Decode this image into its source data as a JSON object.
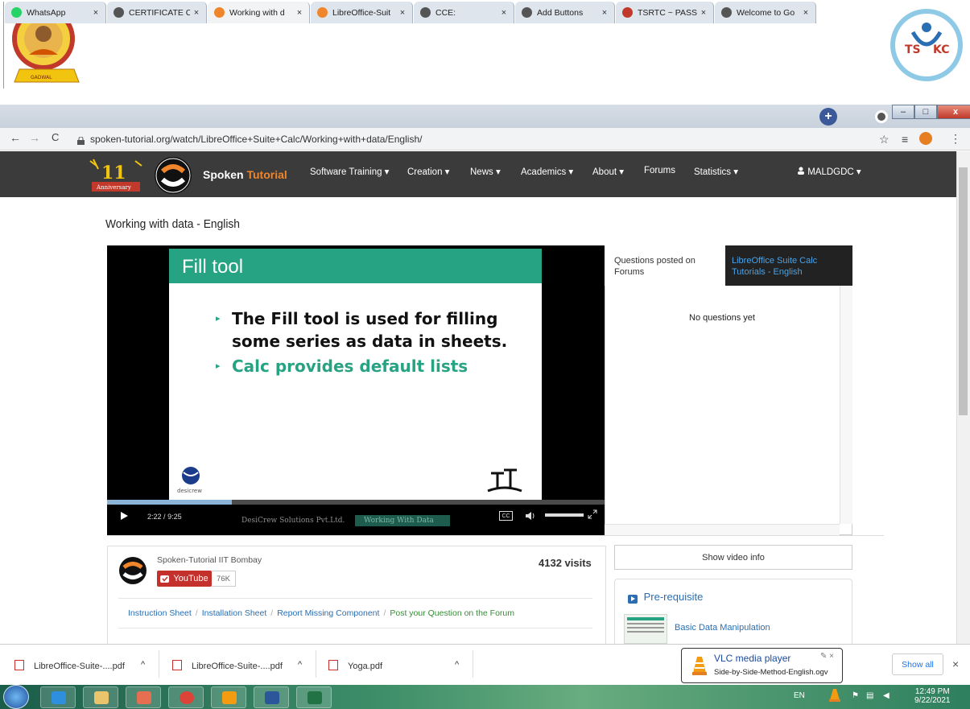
{
  "tabs": [
    {
      "label": "WhatsApp",
      "close": "×",
      "color": "#25d366"
    },
    {
      "label": "CERTIFICATE CO",
      "close": "×",
      "color": "#555555"
    },
    {
      "label": "Working with d",
      "close": "×",
      "color": "#f0862b"
    },
    {
      "label": "LibreOffice-Suit",
      "close": "×",
      "color": "#f0862b"
    },
    {
      "label": "CCE:",
      "close": "×",
      "color": "#555555"
    },
    {
      "label": "Add Buttons",
      "close": "×",
      "color": "#555555"
    },
    {
      "label": "TSRTC ~ PASS",
      "close": "×",
      "color": "#c0392b"
    },
    {
      "label": "Welcome to Go",
      "close": "×",
      "color": "#555555"
    }
  ],
  "browser": {
    "new_tab": "+",
    "url": "spoken-tutorial.org/watch/LibreOffice+Suite+Calc/Working+with+data/English/",
    "back": "←",
    "forward": "→",
    "reload": "C",
    "star": "☆",
    "reading_list": "≡",
    "menu": "⋮"
  },
  "window": {
    "minimize": "–",
    "maximize": "□",
    "close": "x"
  },
  "site": {
    "anniversary": "11",
    "anniversary_label": "Anniversary",
    "brand_a": "Spoken",
    "brand_b": "Tutorial",
    "nav": [
      "Software Training ▾",
      "Creation ▾",
      "News ▾",
      "Academics ▾",
      "About ▾",
      "Forums",
      "Statistics ▾"
    ],
    "user": "MALDGDC ▾"
  },
  "page": {
    "title": "Working with data - English"
  },
  "video": {
    "slide_title": "Fill tool",
    "bullets": [
      {
        "line1": "The Fill tool is used for filling",
        "line2": "some series as data in sheets.",
        "color": "#111111"
      },
      {
        "line1": "Calc provides default lists",
        "line2": "",
        "color": "#26a383"
      }
    ],
    "brand_left": "desicrew",
    "current_time": "2:22",
    "separator": "/",
    "duration": "9:25",
    "progress_fraction": 0.25,
    "caption_left": "DesiCrew Solutions Pvt.Ltd.",
    "caption_right": "Working With Data",
    "cc": "CC"
  },
  "questions": {
    "tab1": "Questions posted on Forums",
    "tab2": "LibreOffice Suite Calc Tutorials - English",
    "empty": "No questions yet"
  },
  "channel": {
    "name": "Spoken-Tutorial IIT Bombay",
    "youtube": "YouTube",
    "subs": "76K",
    "visits": "4132 visits",
    "links": [
      "Instruction Sheet",
      "Installation Sheet",
      "Report Missing Component",
      "Post your Question on the Forum"
    ],
    "sep": "/"
  },
  "sidebar": {
    "show_info": "Show video info",
    "prereq_title": "Pre-requisite",
    "prereq_item": "Basic Data Manipulation"
  },
  "downloads": {
    "items": [
      "LibreOffice-Suite-....pdf",
      "LibreOffice-Suite-....pdf",
      "Yoga.pdf"
    ],
    "caret": "^",
    "show_all": "Show all",
    "close": "×"
  },
  "vlc": {
    "title": "VLC media player",
    "file": "Side-by-Side-Method-English.ogv"
  },
  "tray": {
    "lang": "EN",
    "time": "12:49 PM",
    "date": "9/22/2021"
  }
}
